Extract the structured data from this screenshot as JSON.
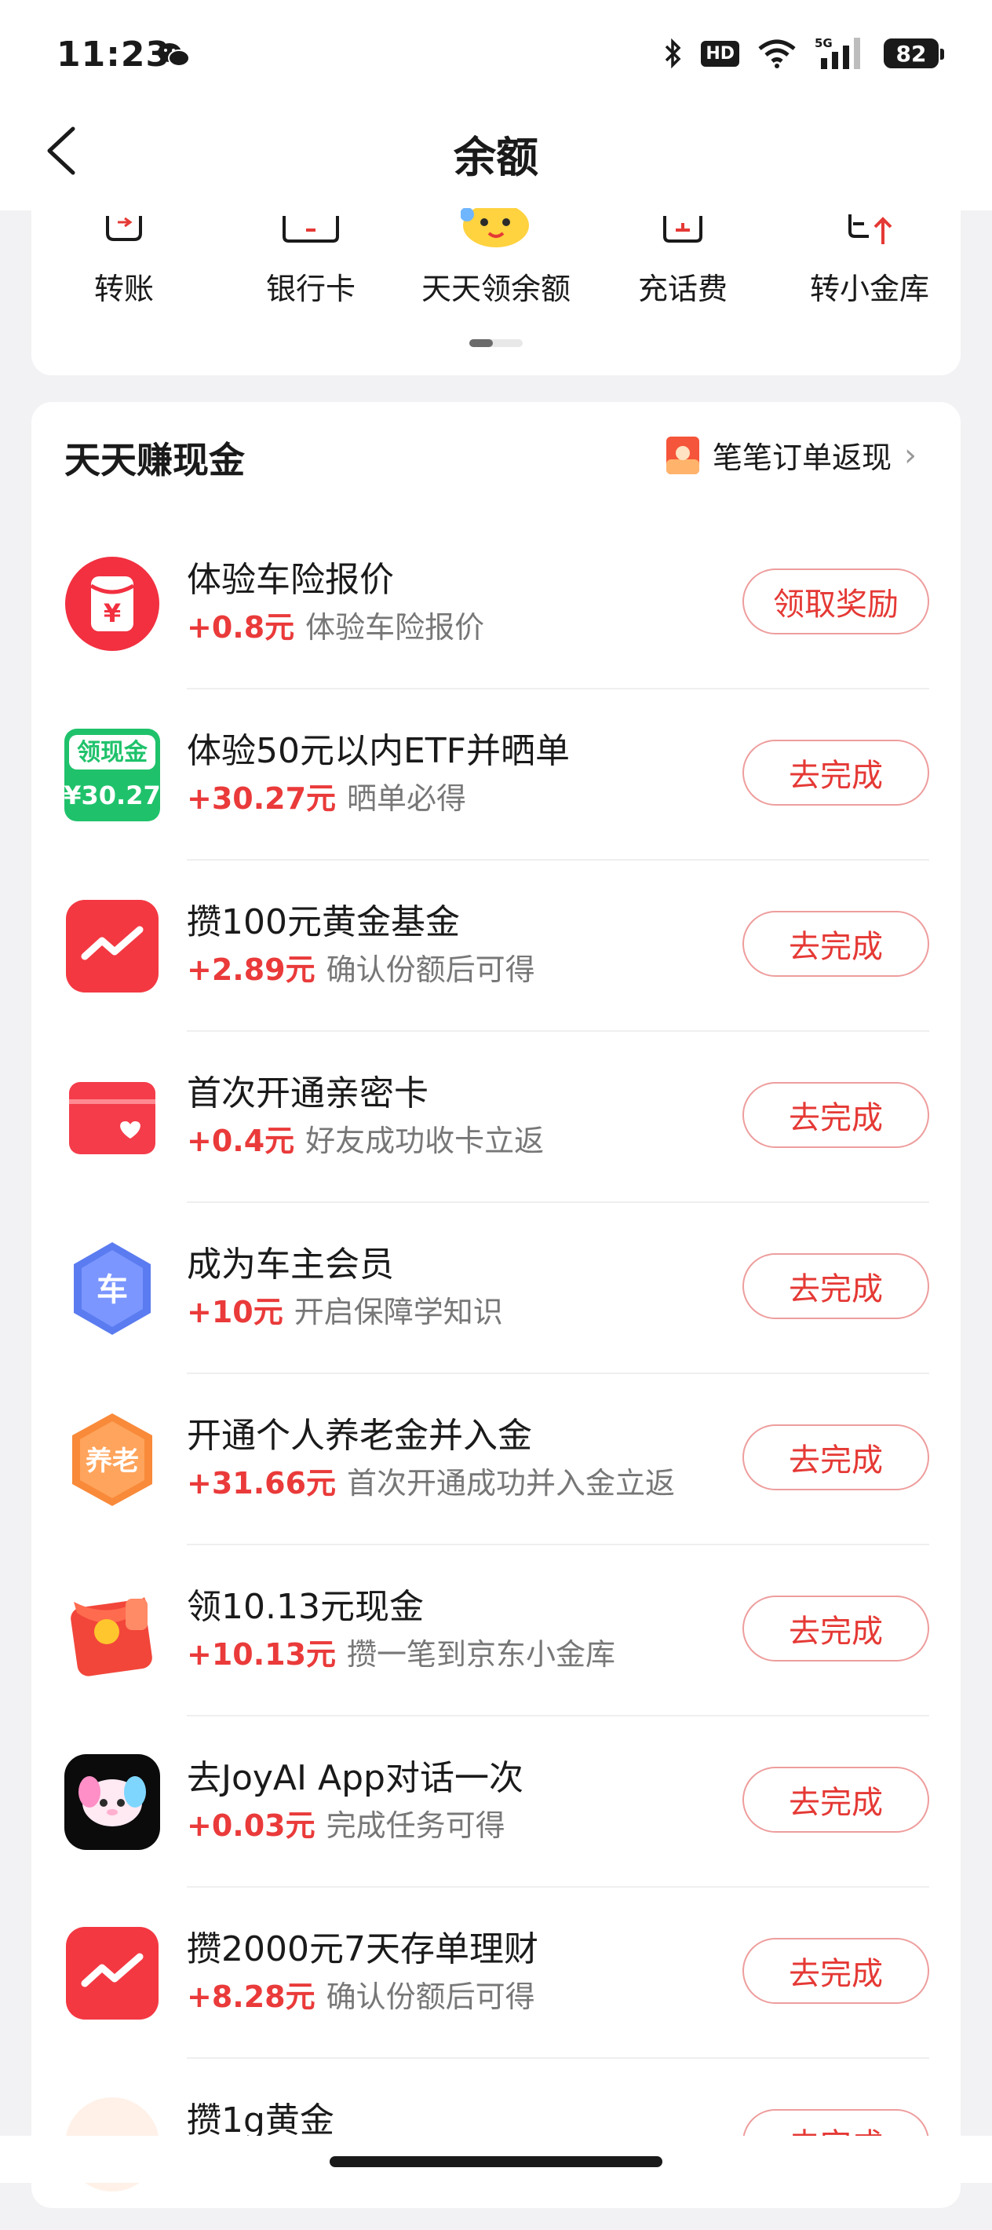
{
  "status_bar": {
    "time": "11:23",
    "hd": "HD",
    "signal": "5G",
    "battery": "82"
  },
  "header": {
    "title": "余额"
  },
  "quick_actions": [
    {
      "label": "转账",
      "icon": "transfer-icon"
    },
    {
      "label": "银行卡",
      "icon": "bank-card-icon"
    },
    {
      "label": "天天领余额",
      "icon": "mascot-icon"
    },
    {
      "label": "充话费",
      "icon": "phone-topup-icon"
    },
    {
      "label": "转小金库",
      "icon": "vault-transfer-icon"
    }
  ],
  "tasks": {
    "title": "天天赚现金",
    "order_link": "笔笔订单返现",
    "items": [
      {
        "name": "体验车险报价",
        "amount": "+0.8元",
        "desc": "体验车险报价",
        "button": "领取奖励",
        "icon": "red-envelope-yuan-icon"
      },
      {
        "name": "体验50元以内ETF并晒单",
        "amount": "+30.27元",
        "desc": "晒单必得",
        "button": "去完成",
        "icon": "cash-coupon-icon",
        "icon_text_top": "领现金",
        "icon_text_bottom": "¥30.27"
      },
      {
        "name": "攒100元黄金基金",
        "amount": "+2.89元",
        "desc": "确认份额后可得",
        "button": "去完成",
        "icon": "trend-chart-icon"
      },
      {
        "name": "首次开通亲密卡",
        "amount": "+0.4元",
        "desc": "好友成功收卡立返",
        "button": "去完成",
        "icon": "heart-card-icon"
      },
      {
        "name": "成为车主会员",
        "amount": "+10元",
        "desc": "开启保障学知识",
        "button": "去完成",
        "icon": "car-shield-icon",
        "icon_text": "车"
      },
      {
        "name": "开通个人养老金并入金",
        "amount": "+31.66元",
        "desc": "首次开通成功并入金立返",
        "button": "去完成",
        "icon": "pension-hexagon-icon",
        "icon_text": "养老"
      },
      {
        "name": "领10.13元现金",
        "amount": "+10.13元",
        "desc": "攒一笔到京东小金库",
        "button": "去完成",
        "icon": "red-packet-icon"
      },
      {
        "name": "去JoyAI App对话一次",
        "amount": "+0.03元",
        "desc": "完成任务可得",
        "button": "去完成",
        "icon": "joyai-app-icon"
      },
      {
        "name": "攒2000元7天存单理财",
        "amount": "+8.28元",
        "desc": "确认份额后可得",
        "button": "去完成",
        "icon": "trend-chart-icon"
      },
      {
        "name": "攒1g黄金",
        "amount": "",
        "desc": "",
        "button": "去完成",
        "icon": "gold-icon"
      }
    ]
  },
  "colors": {
    "accent": "#e53935",
    "amount": "#ea3a3a",
    "background": "#f2f2f4"
  }
}
